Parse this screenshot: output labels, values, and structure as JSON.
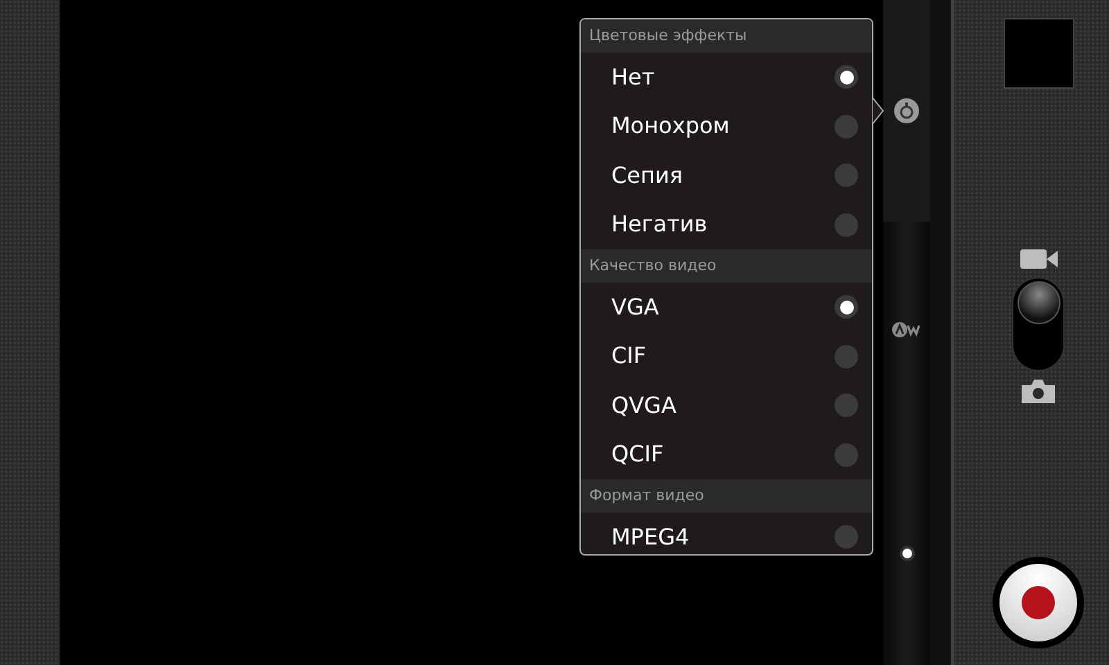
{
  "settings_menu": {
    "sections": [
      {
        "title": "Цветовые эффекты",
        "options": [
          {
            "label": "Нет",
            "selected": true
          },
          {
            "label": "Монохром",
            "selected": false
          },
          {
            "label": "Сепия",
            "selected": false
          },
          {
            "label": "Негатив",
            "selected": false
          }
        ]
      },
      {
        "title": "Качество видео",
        "options": [
          {
            "label": "VGA",
            "selected": true
          },
          {
            "label": "CIF",
            "selected": false
          },
          {
            "label": "QVGA",
            "selected": false
          },
          {
            "label": "QCIF",
            "selected": false
          }
        ]
      },
      {
        "title": "Формат видео",
        "options": [
          {
            "label": "MPEG4",
            "selected": false
          }
        ]
      }
    ]
  },
  "mode_switch": {
    "video_selected": true
  }
}
